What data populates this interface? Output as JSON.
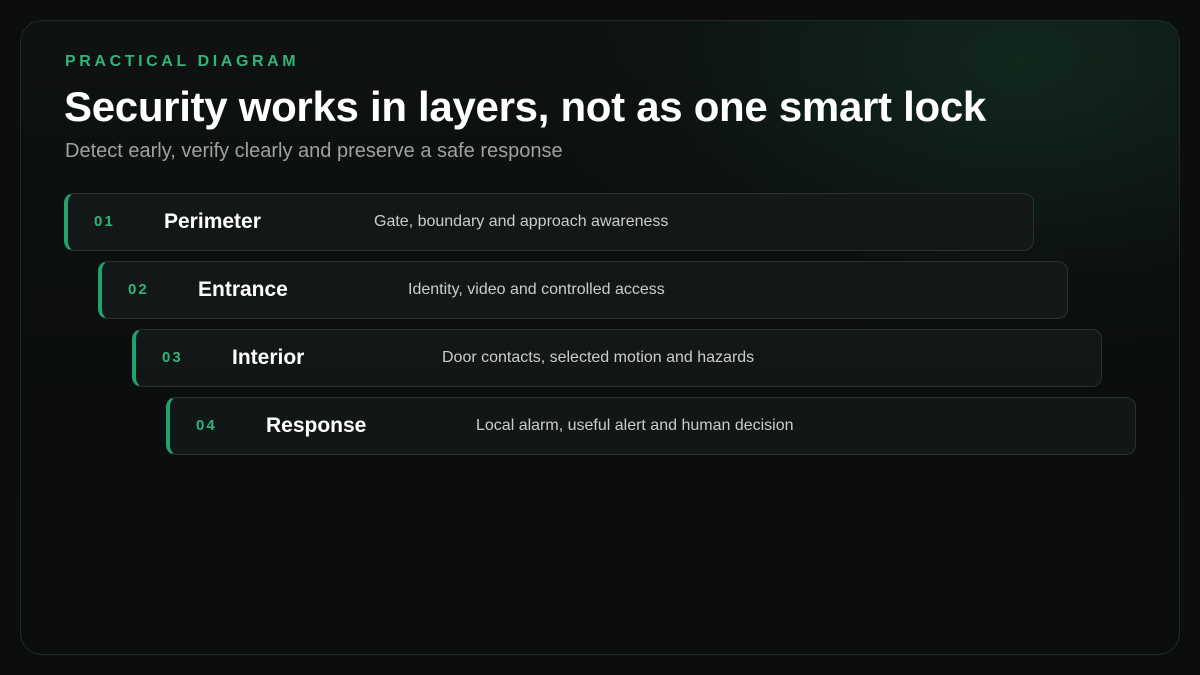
{
  "header": {
    "eyebrow": "PRACTICAL DIAGRAM",
    "title": "Security works in layers, not as one smart lock",
    "subtitle": "Detect early, verify clearly and preserve a safe response"
  },
  "layers": [
    {
      "number": "01",
      "name": "Perimeter",
      "description": "Gate, boundary and approach awareness"
    },
    {
      "number": "02",
      "name": "Entrance",
      "description": "Identity, video and controlled access"
    },
    {
      "number": "03",
      "name": "Interior",
      "description": "Door contacts, selected motion and hazards"
    },
    {
      "number": "04",
      "name": "Response",
      "description": "Local alarm, useful alert and human decision"
    }
  ],
  "colors": {
    "accent": "#2fb57a",
    "background": "#0b0d0e",
    "card": "#161a19"
  }
}
